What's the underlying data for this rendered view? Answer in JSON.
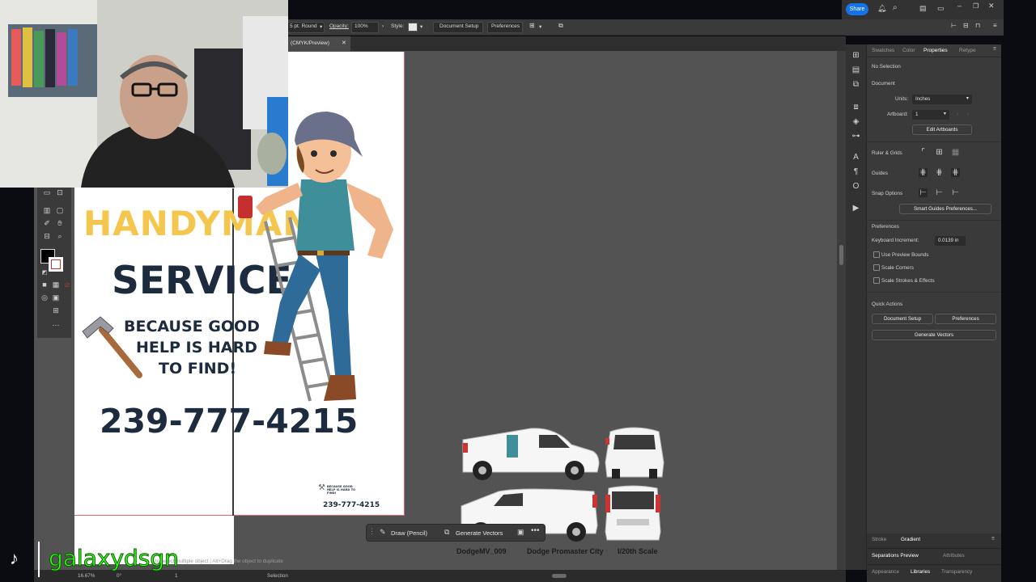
{
  "control_bar": {
    "stroke_profile": "5 pt. Round",
    "opacity_label": "Opacity:",
    "opacity_value": "100%",
    "style_label": "Style:",
    "document_setup": "Document Setup",
    "preferences": "Preferences"
  },
  "top_bar": {
    "share": "Share"
  },
  "document_tab": {
    "title": "(CMYK/Preview)"
  },
  "flyer": {
    "heading1": "HANDYMAN",
    "heading2": "SERVICE",
    "tagline_line1": "BECAUSE GOOD",
    "tagline_line2": "HELP IS HARD",
    "tagline_line3": "TO FIND!",
    "phone": "239-777-4215",
    "small_tagline": "BECAUSE GOOD HELP IS HARD TO FIND!",
    "small_phone": "239-777-4215"
  },
  "vans": {
    "label_model": "DodgeMV_009",
    "label_name": "Dodge Promaster City",
    "label_scale": "I/20th Scale"
  },
  "contextual_bar": {
    "draw": "Draw (Pencil)",
    "generate": "Generate Vectors"
  },
  "panel": {
    "tabs": [
      "Swatches",
      "Color",
      "Properties",
      "Retype"
    ],
    "active_tab": "Properties",
    "no_selection": "No Selection",
    "document": "Document",
    "units_label": "Units:",
    "units_value": "Inches",
    "artboard_label": "Artboard:",
    "artboard_value": "1",
    "edit_artboards": "Edit Artboards",
    "ruler_grids": "Ruler & Grids",
    "guides": "Guides",
    "snap_options": "Snap Options",
    "smart_guides": "Smart Guides Preferences...",
    "preferences": "Preferences",
    "keyboard_increment_label": "Keyboard Increment:",
    "keyboard_increment_value": "0.0139 in",
    "use_preview_bounds": "Use Preview Bounds",
    "scale_corners": "Scale Corners",
    "scale_strokes": "Scale Strokes & Effects",
    "quick_actions": "Quick Actions",
    "qa_document_setup": "Document Setup",
    "qa_preferences": "Preferences",
    "qa_generate_vectors": "Generate Vectors"
  },
  "panel_bottom": {
    "stroke": "Stroke",
    "gradient": "Gradient",
    "separations_preview": "Separations Preview",
    "attributes": "Attributes",
    "appearance": "Appearance",
    "libraries": "Libraries",
    "transparency": "Transparency"
  },
  "status_bar": {
    "hint": "to select multiple object  |  Alt+Drag the object to duplicate",
    "zoom": "16.67%",
    "rotation": "0°",
    "artboard": "1",
    "tool": "Selection"
  },
  "overlay": {
    "tiktok_handle": "galaxydsgn"
  },
  "colors": {
    "accent": "#1473e6",
    "heading_yellow": "#f4c64e",
    "heading_navy": "#1d2b3f",
    "canvas_gray": "#535353",
    "handle_green": "#3cff1e"
  }
}
